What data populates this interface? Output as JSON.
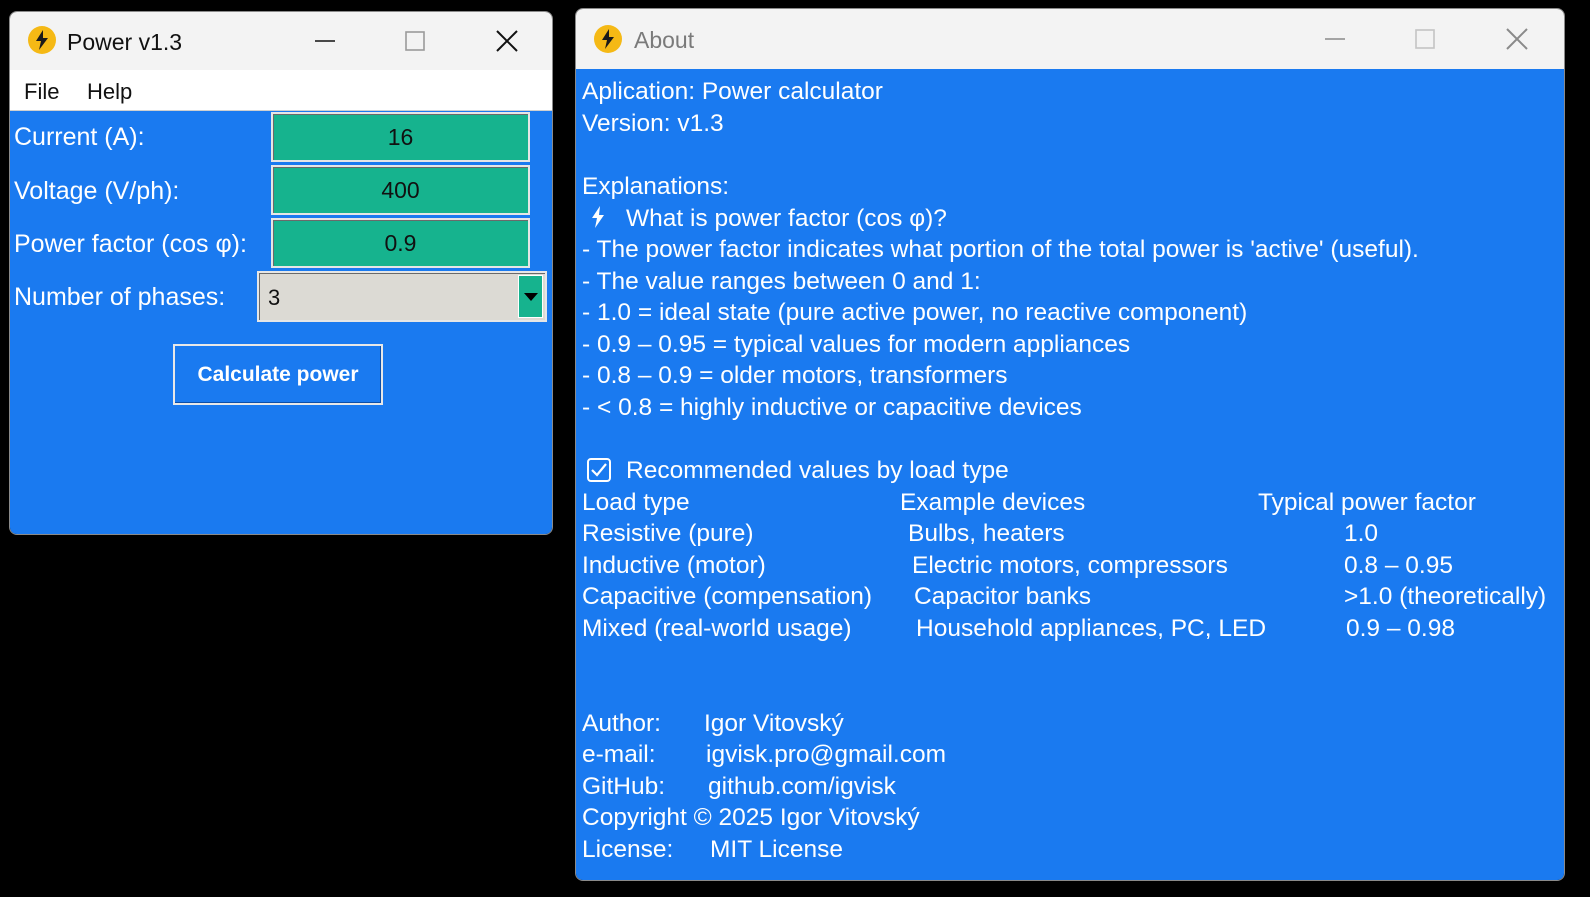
{
  "main_window": {
    "title": "Power v1.3",
    "menu": [
      "File",
      "Help"
    ],
    "fields": [
      {
        "label": "Current (A):",
        "value": "16"
      },
      {
        "label": "Voltage (V/ph):",
        "value": "400"
      },
      {
        "label": "Power factor (cos φ):",
        "value": "0.9"
      }
    ],
    "phases": {
      "label": "Number of phases:",
      "value": "3"
    },
    "calculate_label": "Calculate power"
  },
  "about_window": {
    "title": "About",
    "lines": [
      "Aplication: Power calculator",
      "Version: v1.3",
      "Explanations:",
      "What is power factor (cos φ)?",
      "- The power factor indicates what portion of the total power is 'active' (useful).",
      "- The value ranges between 0 and 1:",
      "- 1.0 = ideal state (pure active power, no reactive component)",
      "- 0.9 – 0.95 = typical values for modern appliances",
      "- 0.8 – 0.9 = older motors, transformers",
      "- < 0.8 = highly inductive or capacitive devices",
      "Recommended values by load type"
    ],
    "table": {
      "headers": [
        "Load type",
        "Example devices",
        "Typical power factor"
      ],
      "rows": [
        [
          "Resistive (pure)",
          "Bulbs, heaters",
          "1.0"
        ],
        [
          "Inductive (motor)",
          "Electric motors, compressors",
          "0.8 – 0.95"
        ],
        [
          "Capacitive (compensation)",
          "Capacitor banks",
          ">1.0 (theoretically)"
        ],
        [
          "Mixed (real-world usage)",
          "Household appliances, PC, LED",
          "0.9 – 0.98"
        ]
      ]
    },
    "info": [
      {
        "label": "Author:",
        "value": "Igor Vitovský"
      },
      {
        "label": "e-mail:",
        "value": "igvisk.pro@gmail.com"
      },
      {
        "label": "GitHub:",
        "value": "github.com/igvisk"
      }
    ],
    "copyright": "Copyright © 2025 Igor Vitovský",
    "license": {
      "label": "License:",
      "value": "MIT License"
    }
  },
  "colors": {
    "client_background": "#1a7af0",
    "field_background": "#16b38e",
    "combo_background": "#dcdad4",
    "titlebar": "#f3f3f3",
    "app_icon": "#f5b915"
  },
  "icons": [
    "lightning-icon",
    "minimize-icon",
    "maximize-icon",
    "close-icon",
    "dropdown-arrow-icon",
    "checkbox-checked-icon"
  ]
}
